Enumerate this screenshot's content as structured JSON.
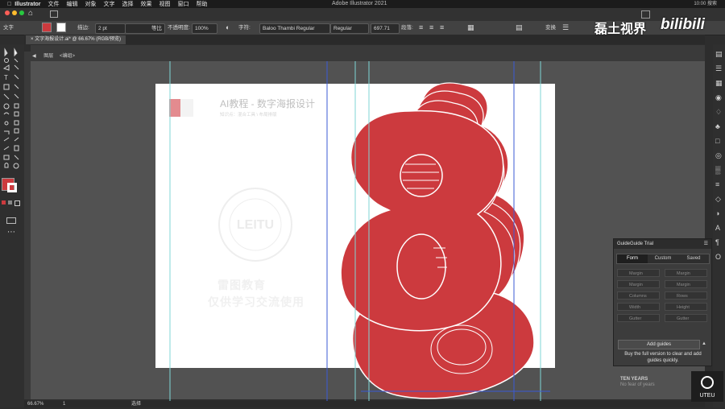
{
  "menubar": {
    "app": "Illustrator",
    "items": [
      "文件",
      "编辑",
      "对象",
      "文字",
      "选择",
      "效果",
      "视图",
      "窗口",
      "帮助"
    ],
    "window_title": "Adobe Illustrator 2021",
    "right_text": "10:00  搜索"
  },
  "controlbar": {
    "label": "文字",
    "stroke_label": "描边:",
    "stroke_value": "2 pt",
    "stroke_profile": "等比",
    "opacity_label": "不透明度:",
    "opacity_value": "100%",
    "char_label": "字符:",
    "font_name": "Baloo Thambi Regular",
    "font_style": "Regular",
    "font_size": "697.71",
    "para_label": "段落:",
    "transform_label": "变换"
  },
  "document": {
    "tab_title": "文字海报设计.ai* @ 66.67% (RGB/预览)",
    "breadcrumb_layer": "图层",
    "breadcrumb_group": "<编组>"
  },
  "artboard": {
    "title": "AI教程 - 数字海报设计",
    "subtitle": "知识点：混合工具 \\ 布局排版",
    "logo_badge": "LEITU",
    "watermark_line1": "雷图教育",
    "watermark_line2": "仅供学习交流使用",
    "big_digit": "8"
  },
  "statusbar": {
    "zoom": "66.67%",
    "page": "1",
    "tool": "选择"
  },
  "guideguide": {
    "title": "GuideGuide Trial",
    "tabs": [
      "Form",
      "Custom",
      "Saved"
    ],
    "active_tab": "Form",
    "fields_left": [
      "Margin",
      "Margin",
      "Columns",
      "Width",
      "Gutter"
    ],
    "fields_right": [
      "Margin",
      "Margin",
      "Rows",
      "Height",
      "Gutter"
    ],
    "add_button": "Add guides",
    "buy_text": "Buy the full version to clear and add guides quickly."
  },
  "overlay": {
    "channel_name": "磊土视界",
    "platform": "bilibili",
    "ten_years": "TEN YEARS",
    "ten_years_sub": "No fear of years",
    "logo_text": "UTEU"
  },
  "colors": {
    "accent_red": "#cc3a3e",
    "fill_swatch": "#cc3a3e",
    "guide_cyan": "#7fd6d6",
    "guide_blue": "#3b5bd6"
  }
}
